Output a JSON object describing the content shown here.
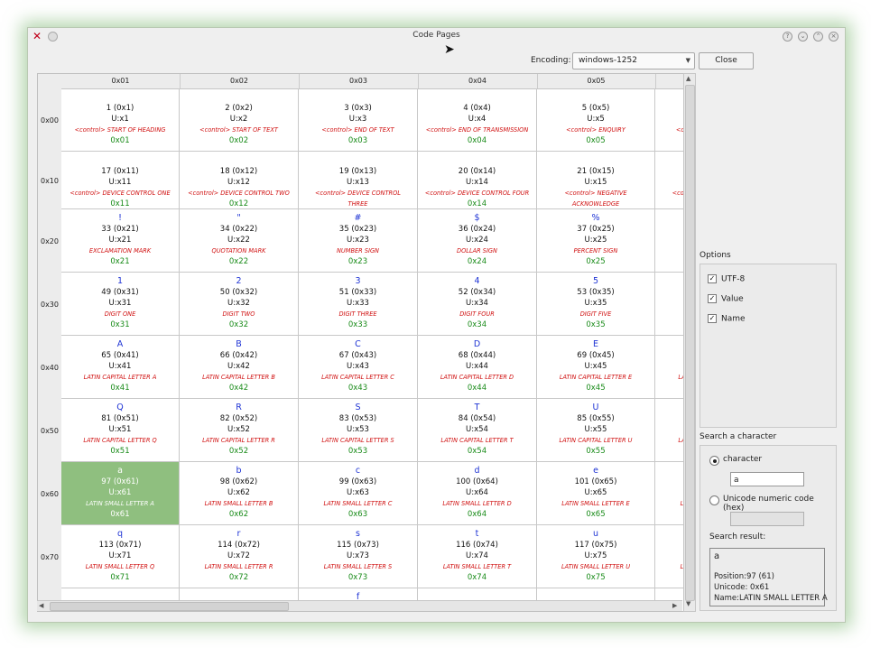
{
  "window": {
    "title": "Code Pages",
    "controls": [
      "help-icon",
      "minimize-icon",
      "maximize-icon",
      "close-icon"
    ]
  },
  "toolbar": {
    "encoding_label": "Encoding:",
    "encoding_value": "windows-1252",
    "close_label": "Close"
  },
  "table": {
    "columns": [
      "0x01",
      "0x02",
      "0x03",
      "0x04",
      "0x05"
    ],
    "rows": [
      {
        "label": "0x00",
        "cells": [
          {
            "ch": "",
            "value": "1 (0x1)",
            "unicode": "U:x1",
            "name": "<control> START OF HEADING",
            "hex": "0x01"
          },
          {
            "ch": "",
            "value": "2 (0x2)",
            "unicode": "U:x2",
            "name": "<control> START OF TEXT",
            "hex": "0x02"
          },
          {
            "ch": "",
            "value": "3 (0x3)",
            "unicode": "U:x3",
            "name": "<control> END OF TEXT",
            "hex": "0x03"
          },
          {
            "ch": "",
            "value": "4 (0x4)",
            "unicode": "U:x4",
            "name": "<control> END OF TRANSMISSION",
            "hex": "0x04"
          },
          {
            "ch": "",
            "value": "5 (0x5)",
            "unicode": "U:x5",
            "name": "<control> ENQUIRY",
            "hex": "0x05"
          },
          {
            "ch": "",
            "value": "",
            "unicode": "",
            "name": "<co",
            "hex": ""
          }
        ]
      },
      {
        "label": "0x10",
        "cells": [
          {
            "ch": "",
            "value": "17 (0x11)",
            "unicode": "U:x11",
            "name": "<control> DEVICE CONTROL ONE",
            "hex": "0x11"
          },
          {
            "ch": "",
            "value": "18 (0x12)",
            "unicode": "U:x12",
            "name": "<control> DEVICE CONTROL TWO",
            "hex": "0x12"
          },
          {
            "ch": "",
            "value": "19 (0x13)",
            "unicode": "U:x13",
            "name": "<control> DEVICE CONTROL",
            "name2": "THREE",
            "hex": "0x13"
          },
          {
            "ch": "",
            "value": "20 (0x14)",
            "unicode": "U:x14",
            "name": "<control> DEVICE CONTROL FOUR",
            "hex": "0x14"
          },
          {
            "ch": "",
            "value": "21 (0x15)",
            "unicode": "U:x15",
            "name": "<control> NEGATIVE",
            "name2": "ACKNOWLEDGE",
            "hex": "0x15"
          },
          {
            "ch": "",
            "value": "",
            "unicode": "",
            "name": "<conti",
            "hex": ""
          }
        ]
      },
      {
        "label": "0x20",
        "cells": [
          {
            "ch": "!",
            "value": "33 (0x21)",
            "unicode": "U:x21",
            "name": "EXCLAMATION MARK",
            "hex": "0x21"
          },
          {
            "ch": "\"",
            "value": "34 (0x22)",
            "unicode": "U:x22",
            "name": "QUOTATION MARK",
            "hex": "0x22"
          },
          {
            "ch": "#",
            "value": "35 (0x23)",
            "unicode": "U:x23",
            "name": "NUMBER SIGN",
            "hex": "0x23"
          },
          {
            "ch": "$",
            "value": "36 (0x24)",
            "unicode": "U:x24",
            "name": "DOLLAR SIGN",
            "hex": "0x24"
          },
          {
            "ch": "%",
            "value": "37 (0x25)",
            "unicode": "U:x25",
            "name": "PERCENT SIGN",
            "hex": "0x25"
          },
          {
            "ch": "",
            "value": "",
            "unicode": "",
            "name": "",
            "hex": ""
          }
        ]
      },
      {
        "label": "0x30",
        "cells": [
          {
            "ch": "1",
            "value": "49 (0x31)",
            "unicode": "U:x31",
            "name": "DIGIT ONE",
            "hex": "0x31"
          },
          {
            "ch": "2",
            "value": "50 (0x32)",
            "unicode": "U:x32",
            "name": "DIGIT TWO",
            "hex": "0x32"
          },
          {
            "ch": "3",
            "value": "51 (0x33)",
            "unicode": "U:x33",
            "name": "DIGIT THREE",
            "hex": "0x33"
          },
          {
            "ch": "4",
            "value": "52 (0x34)",
            "unicode": "U:x34",
            "name": "DIGIT FOUR",
            "hex": "0x34"
          },
          {
            "ch": "5",
            "value": "53 (0x35)",
            "unicode": "U:x35",
            "name": "DIGIT FIVE",
            "hex": "0x35"
          },
          {
            "ch": "",
            "value": "",
            "unicode": "",
            "name": "",
            "hex": ""
          }
        ]
      },
      {
        "label": "0x40",
        "cells": [
          {
            "ch": "A",
            "value": "65 (0x41)",
            "unicode": "U:x41",
            "name": "LATIN CAPITAL LETTER A",
            "hex": "0x41"
          },
          {
            "ch": "B",
            "value": "66 (0x42)",
            "unicode": "U:x42",
            "name": "LATIN CAPITAL LETTER B",
            "hex": "0x42"
          },
          {
            "ch": "C",
            "value": "67 (0x43)",
            "unicode": "U:x43",
            "name": "LATIN CAPITAL LETTER C",
            "hex": "0x43"
          },
          {
            "ch": "D",
            "value": "68 (0x44)",
            "unicode": "U:x44",
            "name": "LATIN CAPITAL LETTER D",
            "hex": "0x44"
          },
          {
            "ch": "E",
            "value": "69 (0x45)",
            "unicode": "U:x45",
            "name": "LATIN CAPITAL LETTER E",
            "hex": "0x45"
          },
          {
            "ch": "",
            "value": "",
            "unicode": "",
            "name": "LA",
            "hex": ""
          }
        ]
      },
      {
        "label": "0x50",
        "cells": [
          {
            "ch": "Q",
            "value": "81 (0x51)",
            "unicode": "U:x51",
            "name": "LATIN CAPITAL LETTER Q",
            "hex": "0x51"
          },
          {
            "ch": "R",
            "value": "82 (0x52)",
            "unicode": "U:x52",
            "name": "LATIN CAPITAL LETTER R",
            "hex": "0x52"
          },
          {
            "ch": "S",
            "value": "83 (0x53)",
            "unicode": "U:x53",
            "name": "LATIN CAPITAL LETTER S",
            "hex": "0x53"
          },
          {
            "ch": "T",
            "value": "84 (0x54)",
            "unicode": "U:x54",
            "name": "LATIN CAPITAL LETTER T",
            "hex": "0x54"
          },
          {
            "ch": "U",
            "value": "85 (0x55)",
            "unicode": "U:x55",
            "name": "LATIN CAPITAL LETTER U",
            "hex": "0x55"
          },
          {
            "ch": "",
            "value": "",
            "unicode": "",
            "name": "LA",
            "hex": ""
          }
        ]
      },
      {
        "label": "0x60",
        "cells": [
          {
            "ch": "a",
            "value": "97 (0x61)",
            "unicode": "U:x61",
            "name": "LATIN SMALL LETTER A",
            "hex": "0x61"
          },
          {
            "ch": "b",
            "value": "98 (0x62)",
            "unicode": "U:x62",
            "name": "LATIN SMALL LETTER B",
            "hex": "0x62"
          },
          {
            "ch": "c",
            "value": "99 (0x63)",
            "unicode": "U:x63",
            "name": "LATIN SMALL LETTER C",
            "hex": "0x63"
          },
          {
            "ch": "d",
            "value": "100 (0x64)",
            "unicode": "U:x64",
            "name": "LATIN SMALL LETTER D",
            "hex": "0x64"
          },
          {
            "ch": "e",
            "value": "101 (0x65)",
            "unicode": "U:x65",
            "name": "LATIN SMALL LETTER E",
            "hex": "0x65"
          },
          {
            "ch": "",
            "value": "",
            "unicode": "",
            "name": "L",
            "hex": ""
          }
        ]
      },
      {
        "label": "0x70",
        "cells": [
          {
            "ch": "q",
            "value": "113 (0x71)",
            "unicode": "U:x71",
            "name": "LATIN SMALL LETTER Q",
            "hex": "0x71"
          },
          {
            "ch": "r",
            "value": "114 (0x72)",
            "unicode": "U:x72",
            "name": "LATIN SMALL LETTER R",
            "hex": "0x72"
          },
          {
            "ch": "s",
            "value": "115 (0x73)",
            "unicode": "U:x73",
            "name": "LATIN SMALL LETTER S",
            "hex": "0x73"
          },
          {
            "ch": "t",
            "value": "116 (0x74)",
            "unicode": "U:x74",
            "name": "LATIN SMALL LETTER T",
            "hex": "0x74"
          },
          {
            "ch": "u",
            "value": "117 (0x75)",
            "unicode": "U:x75",
            "name": "LATIN SMALL LETTER U",
            "hex": "0x75"
          },
          {
            "ch": "",
            "value": "",
            "unicode": "",
            "name": "L",
            "hex": ""
          }
        ]
      },
      {
        "label": "",
        "cells": [
          {
            "ch": "",
            "value": "",
            "unicode": "",
            "name": "",
            "hex": ""
          },
          {
            "ch": "",
            "value": "",
            "unicode": "",
            "name": "",
            "hex": ""
          },
          {
            "ch": "f",
            "value": "",
            "unicode": "",
            "name": "",
            "hex": ""
          },
          {
            "ch": "",
            "value": "",
            "unicode": "",
            "name": "",
            "hex": ""
          },
          {
            "ch": "",
            "value": "",
            "unicode": "",
            "name": "",
            "hex": ""
          },
          {
            "ch": "",
            "value": "",
            "unicode": "",
            "name": "",
            "hex": ""
          }
        ]
      }
    ],
    "selected": {
      "row": 6,
      "col": 0
    }
  },
  "options": {
    "title": "Options",
    "items": [
      {
        "label": "UTF-8",
        "checked": true
      },
      {
        "label": "Value",
        "checked": true
      },
      {
        "label": "Name",
        "checked": true
      }
    ]
  },
  "search": {
    "title": "Search a character",
    "mode_character_label": "character",
    "mode_unicode_label": "Unicode numeric code (hex)",
    "selected_mode": "character",
    "character_value": "a",
    "unicode_value": "",
    "result_label": "Search result:",
    "result_char": "a",
    "result_position": "Position:97 (61)",
    "result_unicode": "Unicode: 0x61",
    "result_name": "Name:LATIN SMALL LETTER A"
  },
  "colors": {
    "selected_cell": "#8fbf7f",
    "char": "#1e33d4",
    "name": "#d01010",
    "hex": "#178a17"
  }
}
